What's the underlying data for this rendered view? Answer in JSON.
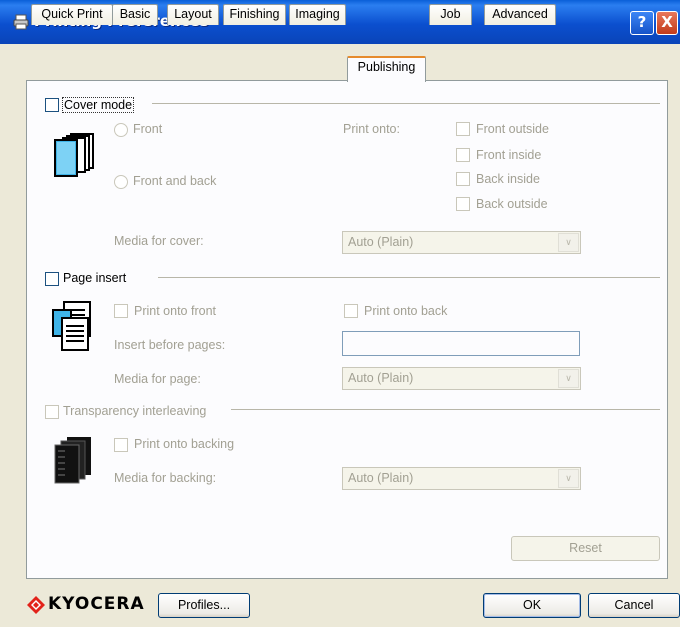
{
  "window": {
    "title": "Printing Preferences",
    "help_label": "?",
    "close_label": "X"
  },
  "tabs": [
    {
      "label": "Quick Print",
      "active": false
    },
    {
      "label": "Basic",
      "active": false
    },
    {
      "label": "Layout",
      "active": false
    },
    {
      "label": "Finishing",
      "active": false
    },
    {
      "label": "Imaging",
      "active": false
    },
    {
      "label": "Publishing",
      "active": true
    },
    {
      "label": "Job",
      "active": false
    },
    {
      "label": "Advanced",
      "active": false
    }
  ],
  "cover": {
    "checkbox_label": "Cover mode",
    "checked": false,
    "radio_front": "Front",
    "radio_front_back": "Front and back",
    "print_onto_label": "Print onto:",
    "options": [
      "Front outside",
      "Front inside",
      "Back inside",
      "Back outside"
    ],
    "media_label": "Media for cover:",
    "media_value": "Auto (Plain)"
  },
  "page_insert": {
    "checkbox_label": "Page insert",
    "checked": false,
    "print_front": "Print onto front",
    "print_back": "Print onto back",
    "insert_before_label": "Insert before pages:",
    "insert_before_value": "",
    "media_label": "Media for page:",
    "media_value": "Auto (Plain)"
  },
  "transparency": {
    "checkbox_label": "Transparency interleaving",
    "checked": false,
    "print_backing": "Print onto backing",
    "media_label": "Media for backing:",
    "media_value": "Auto (Plain)"
  },
  "buttons": {
    "reset": "Reset",
    "profiles": "Profiles...",
    "ok": "OK",
    "cancel": "Cancel"
  },
  "brand": {
    "name": "KYOCERA",
    "color": "#e2231a"
  },
  "colors": {
    "titlebar": "#0a4fcf",
    "active_tab_accent": "#e68b2c",
    "dialog_bg": "#ece9d8"
  }
}
